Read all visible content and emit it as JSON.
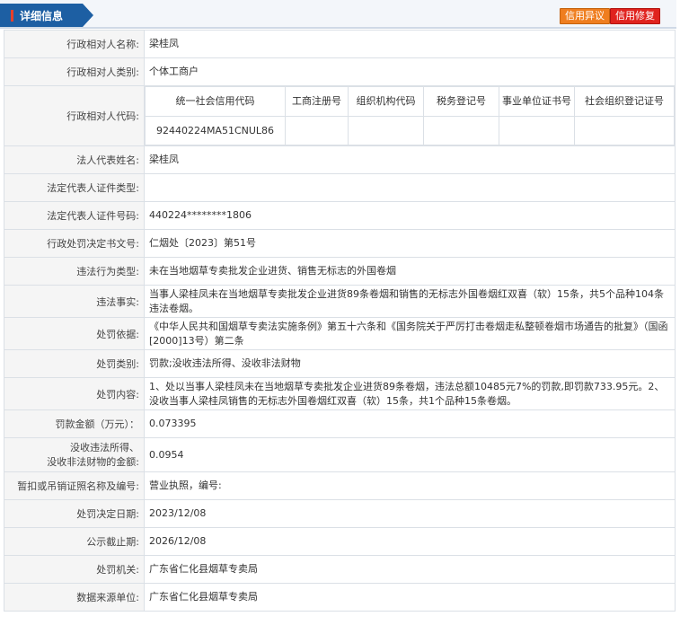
{
  "header": {
    "title": "详细信息",
    "buttons": {
      "objection": "信用异议",
      "repair": "信用修复"
    }
  },
  "codes_table": {
    "headers": [
      "统一社会信用代码",
      "工商注册号",
      "组织机构代码",
      "税务登记号",
      "事业单位证书号",
      "社会组织登记证号"
    ],
    "values": [
      "92440224MA51CNUL86",
      "",
      "",
      "",
      "",
      ""
    ]
  },
  "rows": {
    "name": {
      "label": "行政相对人名称:",
      "value": "梁桂凤"
    },
    "category": {
      "label": "行政相对人类别:",
      "value": "个体工商户"
    },
    "code": {
      "label": "行政相对人代码:"
    },
    "legal_rep": {
      "label": "法人代表姓名:",
      "value": "梁桂凤"
    },
    "id_type": {
      "label": "法定代表人证件类型:",
      "value": ""
    },
    "id_number": {
      "label": "法定代表人证件号码:",
      "value": "440224********1806"
    },
    "decision_no": {
      "label": "行政处罚决定书文号:",
      "value": "仁烟处〔2023〕第51号"
    },
    "violation_type": {
      "label": "违法行为类型:",
      "value": "未在当地烟草专卖批发企业进货、销售无标志的外国卷烟"
    },
    "facts": {
      "label": "违法事实:",
      "value": "当事人梁桂凤未在当地烟草专卖批发企业进货89条卷烟和销售的无标志外国卷烟红双喜（软）15条，共5个品种104条违法卷烟。"
    },
    "basis": {
      "label": "处罚依据:",
      "value": "《中华人民共和国烟草专卖法实施条例》第五十六条和《国务院关于严厉打击卷烟走私整顿卷烟市场通告的批复》（国函[2000]13号）第二条"
    },
    "penalty_type": {
      "label": "处罚类别:",
      "value": "罚款;没收违法所得、没收非法财物"
    },
    "content": {
      "label": "处罚内容:",
      "value": "1、处以当事人梁桂凤未在当地烟草专卖批发企业进货89条卷烟，违法总额10485元7%的罚款,即罚款733.95元。2、没收当事人梁桂凤销售的无标志外国卷烟红双喜（软）15条，共1个品种15条卷烟。"
    },
    "fine": {
      "label": "罚款金额（万元）：",
      "value": "0.073395"
    },
    "confiscated": {
      "label_line1": "没收违法所得、",
      "label_line2": "没收非法财物的金额:",
      "value": "0.0954"
    },
    "license": {
      "label": "暂扣或吊销证照名称及编号:",
      "value": "营业执照，编号:"
    },
    "decision_date": {
      "label": "处罚决定日期:",
      "value": "2023/12/08"
    },
    "publicity_end": {
      "label": "公示截止期:",
      "value": "2026/12/08"
    },
    "authority": {
      "label": "处罚机关:",
      "value": "广东省仁化县烟草专卖局"
    },
    "source": {
      "label": "数据来源单位:",
      "value": "广东省仁化县烟草专卖局"
    }
  }
}
